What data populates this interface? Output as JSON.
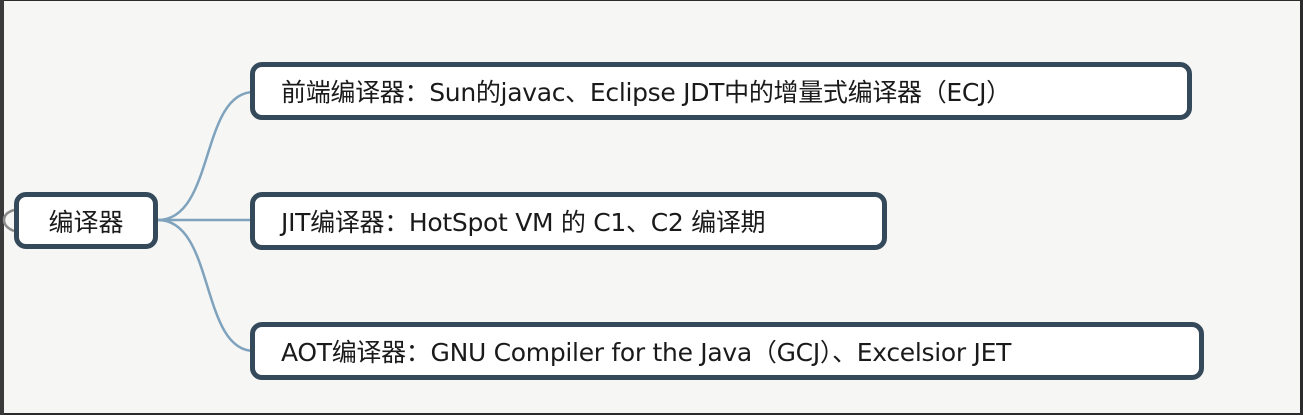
{
  "diagram": {
    "type": "mind-map",
    "colors": {
      "node_border": "#34495a",
      "connector": "#7fa2bd",
      "background": "#f6f6f4"
    },
    "root": {
      "label": "编译器"
    },
    "branches": [
      {
        "label": "前端编译器：Sun的javac、Eclipse JDT中的增量式编译器（ECJ）"
      },
      {
        "label": "JIT编译器：HotSpot VM 的 C1、C2 编译期"
      },
      {
        "label": "AOT编译器：GNU Compiler for the Java（GCJ）、Excelsior JET"
      }
    ]
  }
}
